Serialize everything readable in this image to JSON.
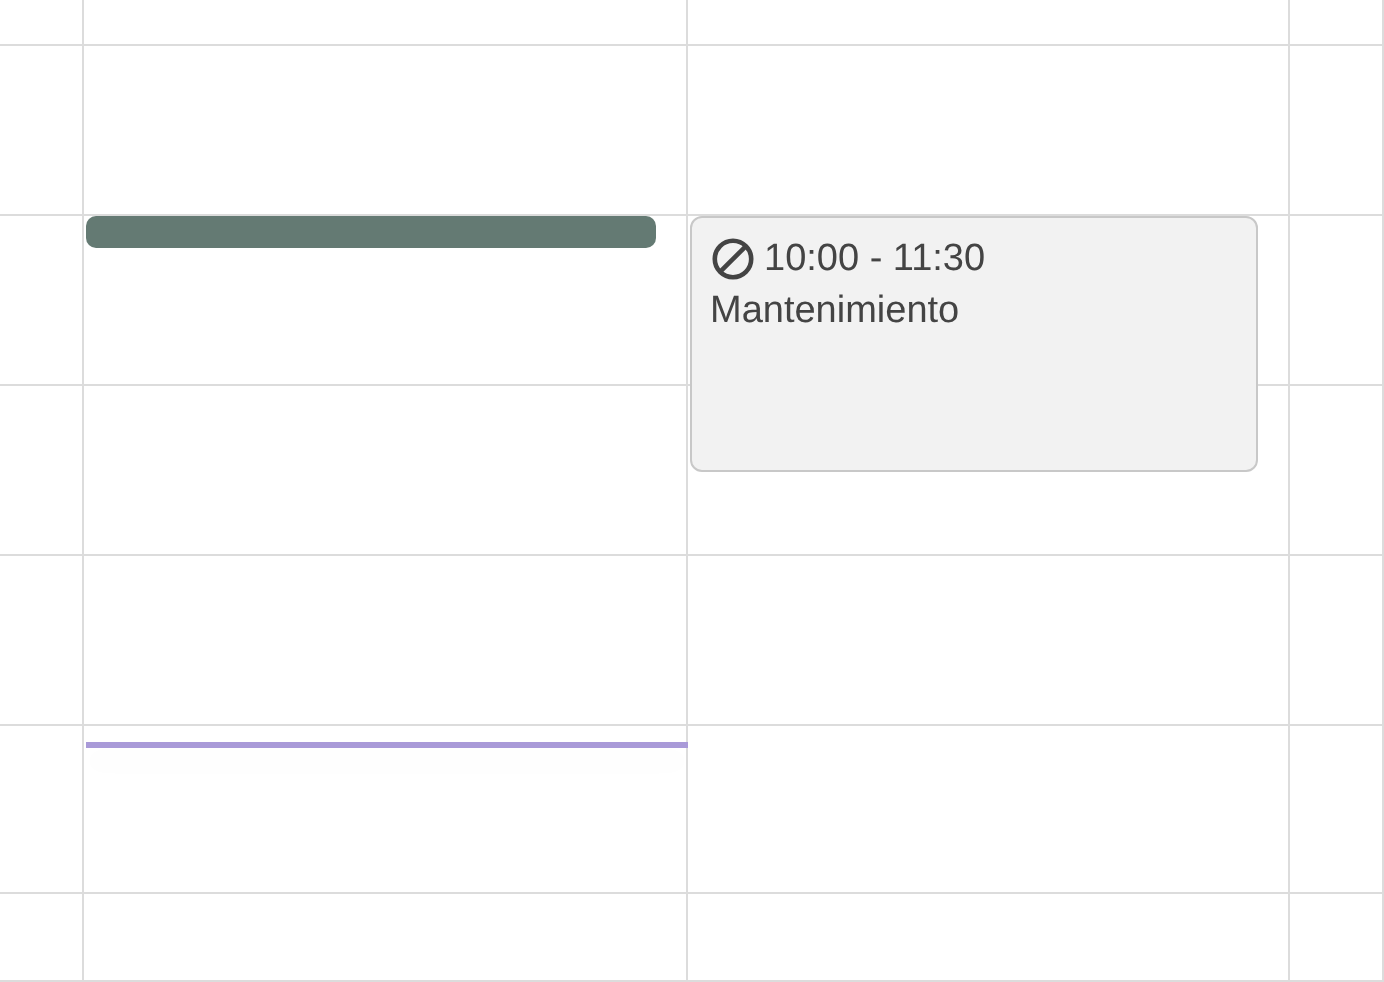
{
  "events": [
    {
      "kind": "collapsed"
    },
    {
      "kind": "blocked",
      "time": "10:00 - 11:30",
      "title": "Mantenimiento"
    }
  ]
}
